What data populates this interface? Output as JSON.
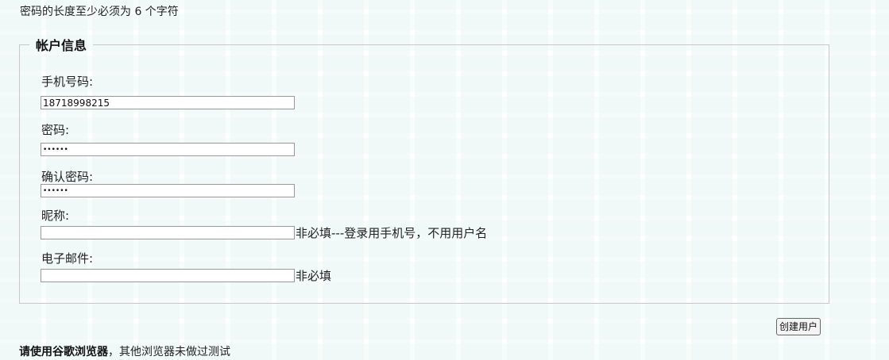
{
  "notice": "密码的长度至少必须为 6 个字符",
  "account_section": {
    "legend": "帐户信息",
    "phone": {
      "label": "手机号码:",
      "value": "18718998215"
    },
    "password": {
      "label": "密码:",
      "value": "••••••"
    },
    "confirm_password": {
      "label": "确认密码:",
      "value": "••••••"
    },
    "nickname": {
      "label": "昵称:",
      "value": "",
      "hint": "非必填---登录用手机号，不用用户名"
    },
    "email": {
      "label": "电子邮件:",
      "value": "",
      "hint": "非必填"
    }
  },
  "create_button": "创建用户",
  "footer": {
    "bold_text": "请使用谷歌浏览器",
    "rest_text": "，其他浏览器未做过测试"
  }
}
